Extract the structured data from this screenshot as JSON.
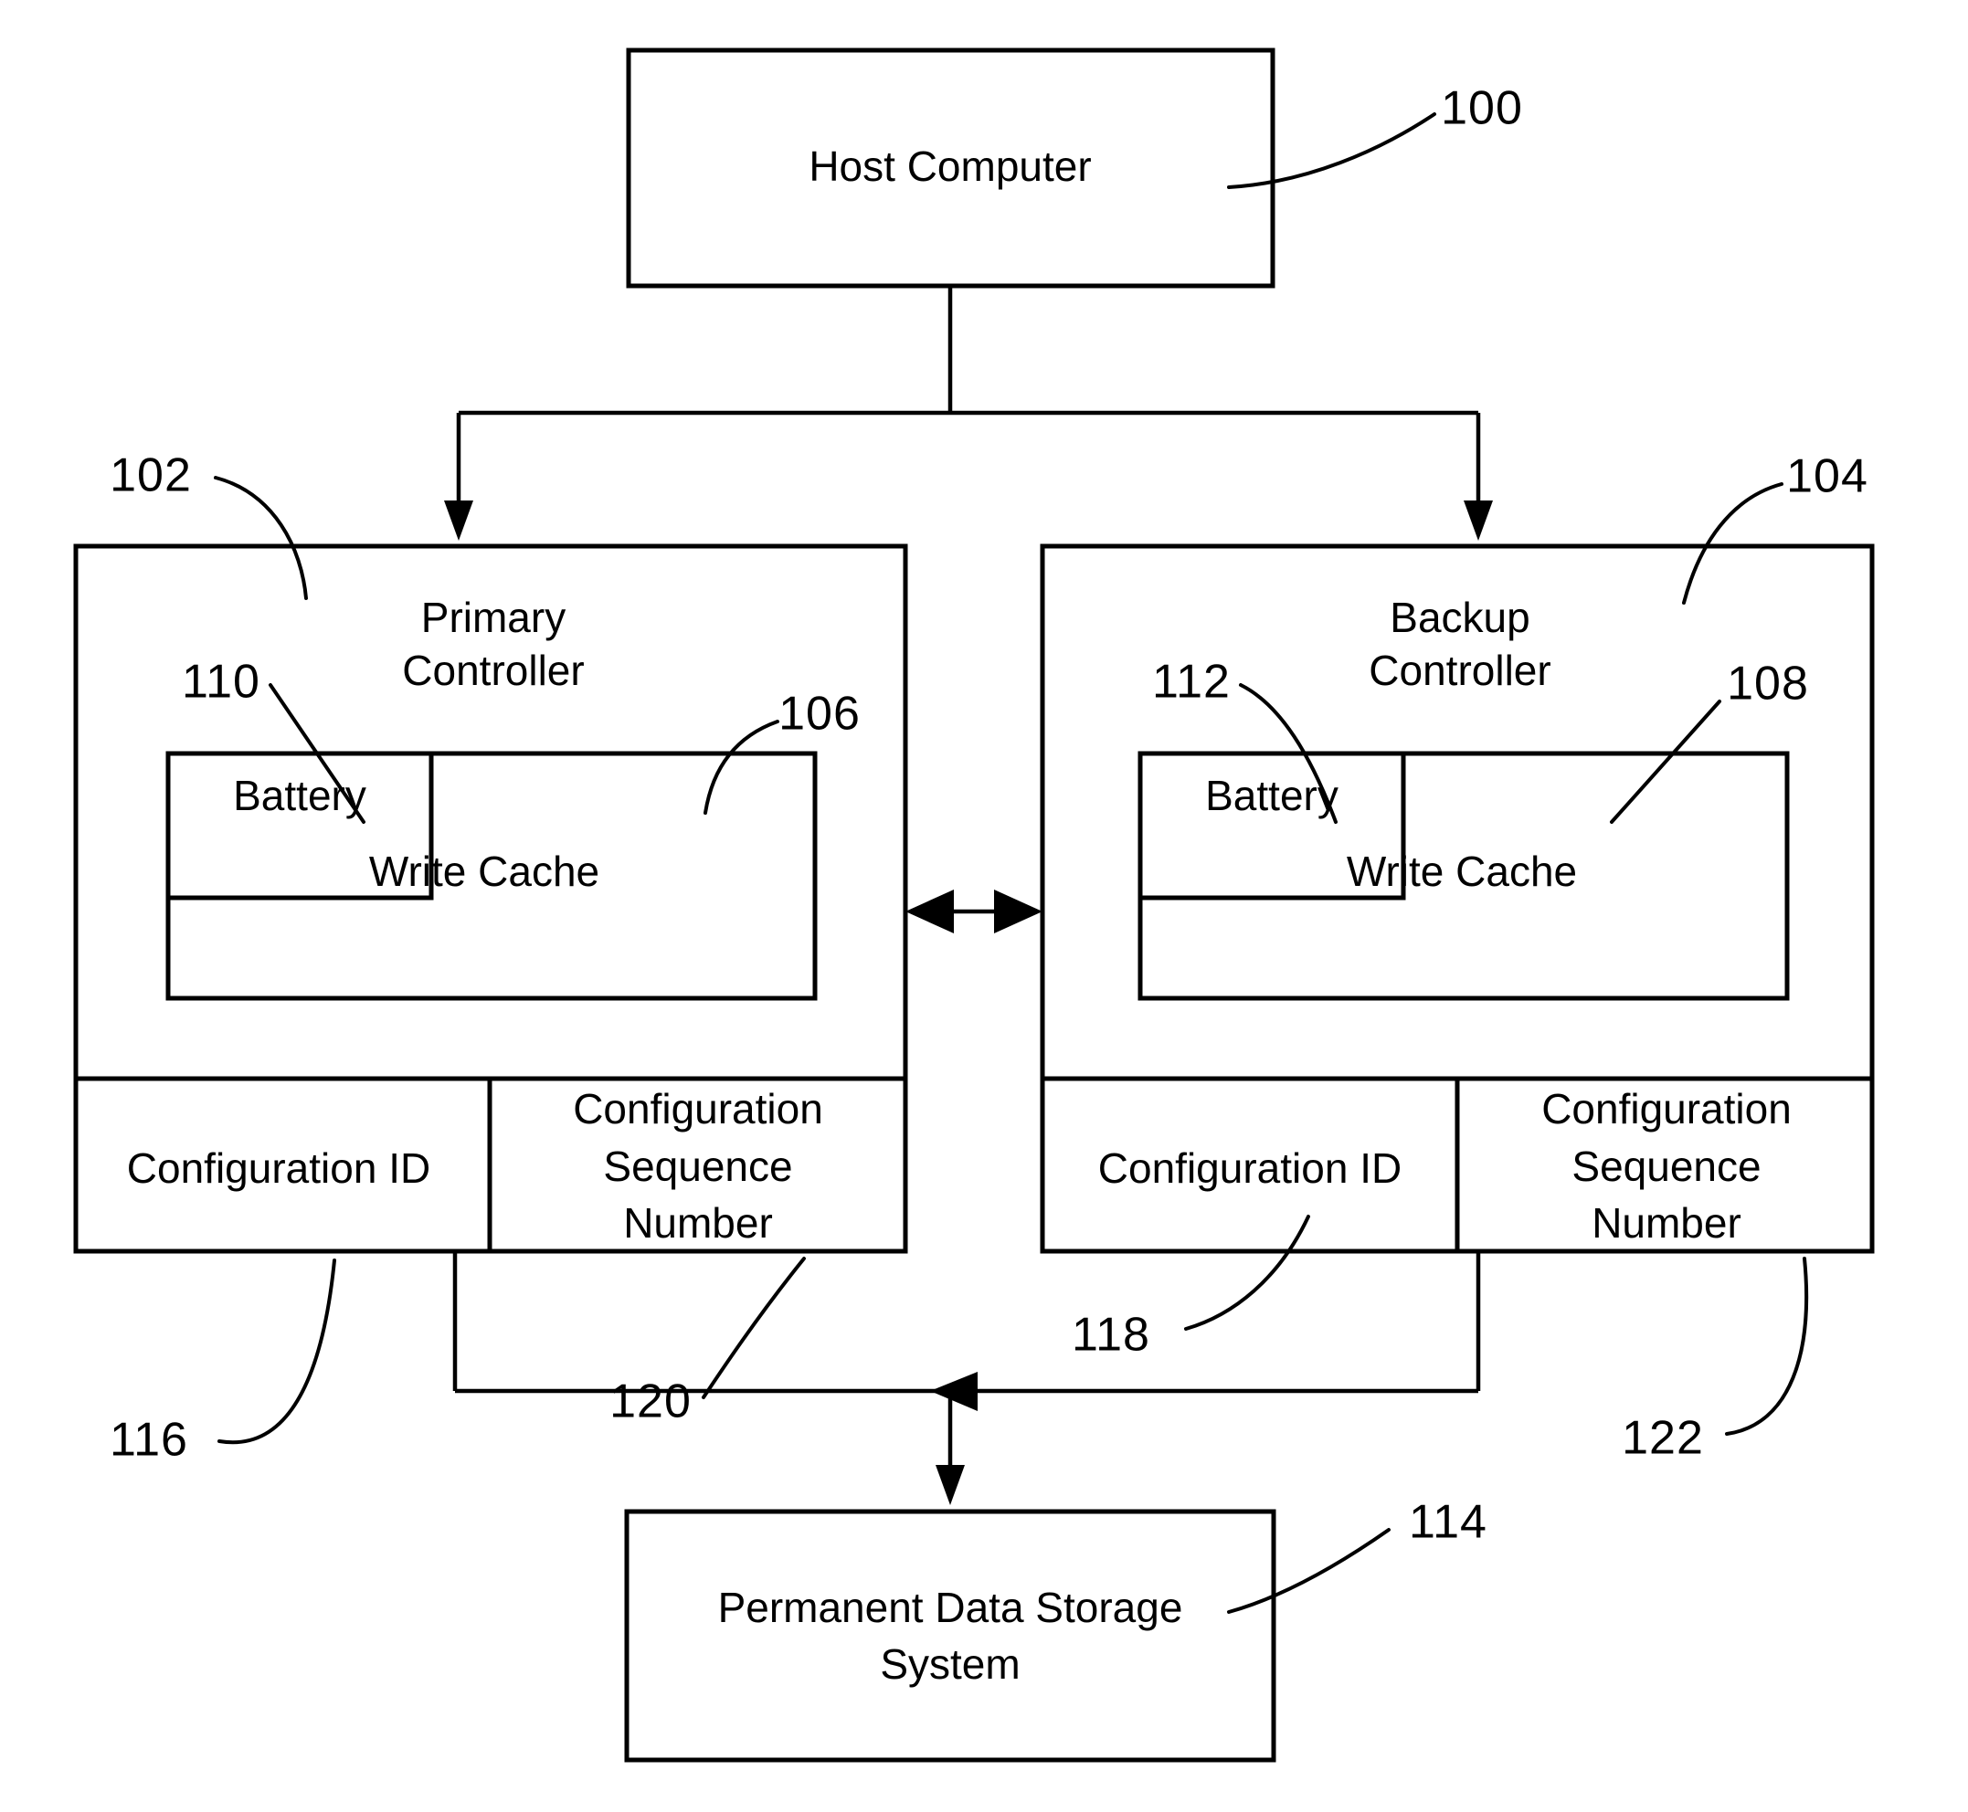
{
  "figure": {
    "type": "patent-block-diagram",
    "background_color": "#ffffff",
    "line_color": "#000000"
  },
  "blocks": {
    "host_computer": {
      "label": "Host Computer",
      "ref": "100"
    },
    "primary_controller": {
      "label_line1": "Primary",
      "label_line2": "Controller",
      "ref": "102",
      "battery": {
        "label": "Battery",
        "ref": "110"
      },
      "write_cache": {
        "label": "Write Cache",
        "ref": "106"
      },
      "configuration_id": {
        "label": "Configuration ID",
        "ref": "116"
      },
      "configuration_sequence_number": {
        "line1": "Configuration",
        "line2": "Sequence",
        "line3": "Number",
        "ref": "120"
      }
    },
    "backup_controller": {
      "label_line1": "Backup",
      "label_line2": "Controller",
      "ref": "104",
      "battery": {
        "label": "Battery",
        "ref": "112"
      },
      "write_cache": {
        "label": "Write Cache",
        "ref": "108"
      },
      "configuration_id": {
        "label": "Configuration ID",
        "ref": "118"
      },
      "configuration_sequence_number": {
        "line1": "Configuration",
        "line2": "Sequence",
        "line3": "Number",
        "ref": "122"
      }
    },
    "permanent_storage": {
      "label_line1": "Permanent Data Storage",
      "label_line2": "System",
      "ref": "114"
    }
  },
  "connections": [
    {
      "name": "host-to-controllers-bus",
      "style": "split-bus",
      "arrows": "down-both"
    },
    {
      "name": "primary-backup-link",
      "style": "horizontal",
      "arrows": "both"
    },
    {
      "name": "controllers-to-storage-bus",
      "style": "merge-bus",
      "arrows": "left-and-down"
    }
  ]
}
